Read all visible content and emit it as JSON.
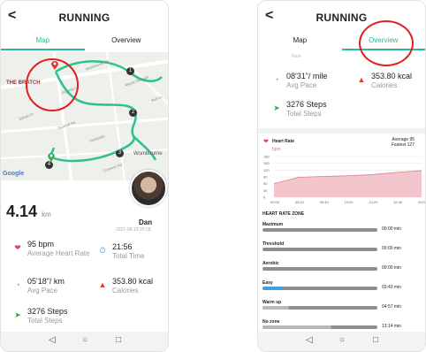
{
  "left_screen": {
    "back_glyph": "<",
    "title": "RUNNING",
    "tabs": [
      {
        "label": "Map",
        "active": true
      },
      {
        "label": "Overview",
        "active": false
      }
    ],
    "map": {
      "place_label": "THE BRATCH",
      "road_labels": [
        "Wombourne Rd",
        "Giggetty Ln",
        "Dunstall Rd",
        "Mount Pleasant",
        "Bull Ln",
        "Parklands",
        "Wombourne",
        "Common Rd",
        "Sylvan Dr"
      ],
      "markers": [
        "1",
        "2",
        "3",
        "4"
      ],
      "google_label": "Google"
    },
    "distance": {
      "value": "4.14",
      "unit": "km"
    },
    "user": {
      "name": "Dan",
      "timestamp": "2021-08-19 20:18"
    },
    "metrics": [
      {
        "icon": "heart-rate-icon",
        "value": "95 bpm",
        "label": "Average Heart Rate"
      },
      {
        "icon": "stopwatch-icon",
        "value": "21:56",
        "label": "Total Time"
      },
      {
        "icon": "pace-gauge-icon",
        "value": "05'18\"/ km",
        "label": "Avg Pace"
      },
      {
        "icon": "calories-flame-icon",
        "value": "353.80 kcal",
        "label": "Calories"
      },
      {
        "icon": "steps-icon",
        "value": "3276 Steps",
        "label": "Total Steps"
      }
    ]
  },
  "right_screen": {
    "back_glyph": "<",
    "title": "RUNNING",
    "tabs": [
      {
        "label": "Map",
        "active": false
      },
      {
        "label": "Overview",
        "active": true
      }
    ],
    "partial_label": "Rate",
    "metrics": [
      {
        "icon": "pace-gauge-icon",
        "value": "08'31\"/ mile",
        "label": "Avg Pace"
      },
      {
        "icon": "calories-flame-icon",
        "value": "353.80 kcal",
        "label": "Calories"
      },
      {
        "icon": "steps-icon",
        "value": "3276 Steps",
        "label": "Total Steps"
      }
    ],
    "heart_rate": {
      "title": "Heart Rate",
      "unit": "bpm",
      "average": "Average 95",
      "fastest": "Fastest 127"
    },
    "chart_data": {
      "type": "area",
      "x": [
        "00:00",
        "03:20",
        "06:40",
        "10:00",
        "13:20",
        "16:40",
        "20:00"
      ],
      "values": [
        60,
        88,
        92,
        95,
        100,
        110,
        118
      ],
      "y_ticks": [
        "180",
        "150",
        "120",
        "90",
        "60",
        "30",
        "0"
      ],
      "ylim": [
        0,
        180
      ],
      "fill_color": "#f2c6cc",
      "line_color": "#e07a86"
    },
    "zone_title": "HEART RATE ZONE",
    "zones": [
      {
        "name": "Maximum",
        "time": "00:00 min",
        "fraction": 0.0,
        "color": "#8d8d8d"
      },
      {
        "name": "Threshold",
        "time": "00:00 min",
        "fraction": 0.0,
        "color": "#8d8d8d"
      },
      {
        "name": "Aerobic",
        "time": "00:00 min",
        "fraction": 0.0,
        "color": "#8d8d8d"
      },
      {
        "name": "Easy",
        "time": "03:43 min",
        "fraction": 0.17,
        "color": "#3aa3e0"
      },
      {
        "name": "Warm up",
        "time": "04:57 min",
        "fraction": 0.23,
        "color": "#b8b8b8"
      },
      {
        "name": "No zone",
        "time": "13:14 min",
        "fraction": 0.6,
        "color": "#b8b8b8"
      }
    ]
  },
  "colors": {
    "accent": "#2bb89a",
    "highlight": "#e02020",
    "heart": "#e0446a",
    "stopwatch": "#2a9be0",
    "pace": "#f08030",
    "flame": "#e04020",
    "steps": "#22b04a"
  },
  "navbar": {
    "back": "◁",
    "home": "○",
    "recent": "□"
  }
}
